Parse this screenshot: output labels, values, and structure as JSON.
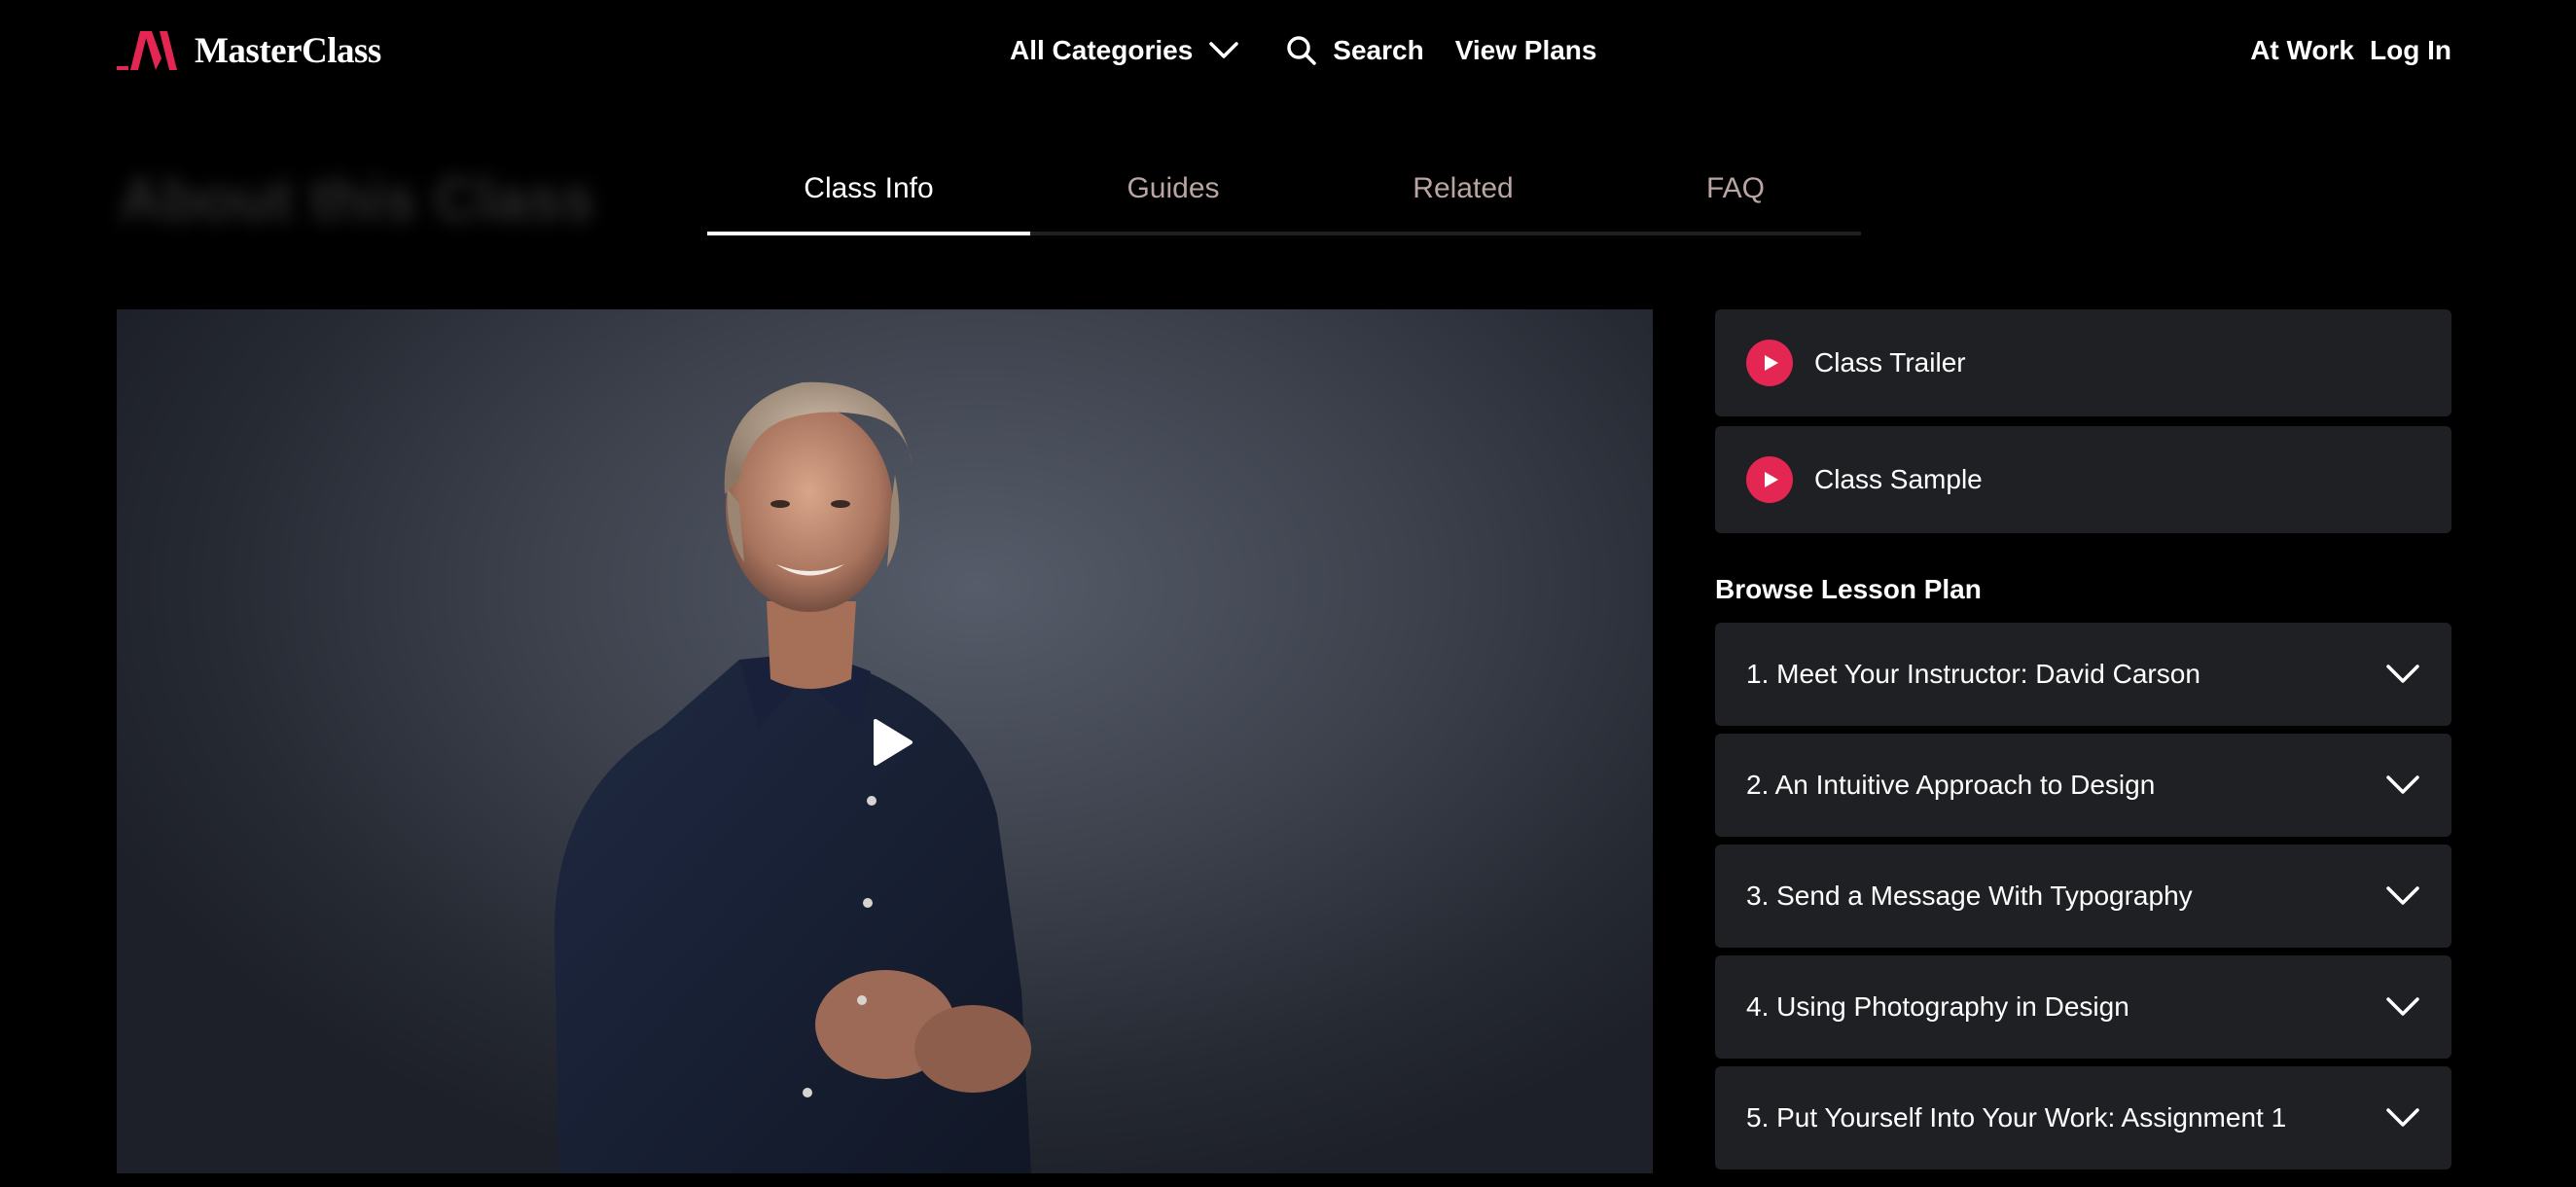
{
  "brand": {
    "name": "MasterClass",
    "accent": "#e32652"
  },
  "header": {
    "categories_label": "All Categories",
    "search_label": "Search",
    "plans_label": "View Plans",
    "at_work_label": "At Work",
    "login_label": "Log In"
  },
  "page": {
    "blurred_heading": "About this Class"
  },
  "tabs": [
    {
      "label": "Class Info",
      "active": true
    },
    {
      "label": "Guides",
      "active": false
    },
    {
      "label": "Related",
      "active": false
    },
    {
      "label": "FAQ",
      "active": false
    }
  ],
  "media": {
    "trailer_label": "Class Trailer",
    "sample_label": "Class Sample"
  },
  "lesson_plan": {
    "heading": "Browse Lesson Plan",
    "lessons": [
      {
        "title": "1. Meet Your Instructor: David Carson"
      },
      {
        "title": "2. An Intuitive Approach to Design"
      },
      {
        "title": "3. Send a Message With Typography"
      },
      {
        "title": "4. Using Photography in Design"
      },
      {
        "title": "5. Put Yourself Into Your Work: Assignment 1"
      }
    ]
  },
  "icons": [
    "masterclass-logo-icon",
    "chevron-down-icon",
    "search-icon",
    "play-icon"
  ]
}
